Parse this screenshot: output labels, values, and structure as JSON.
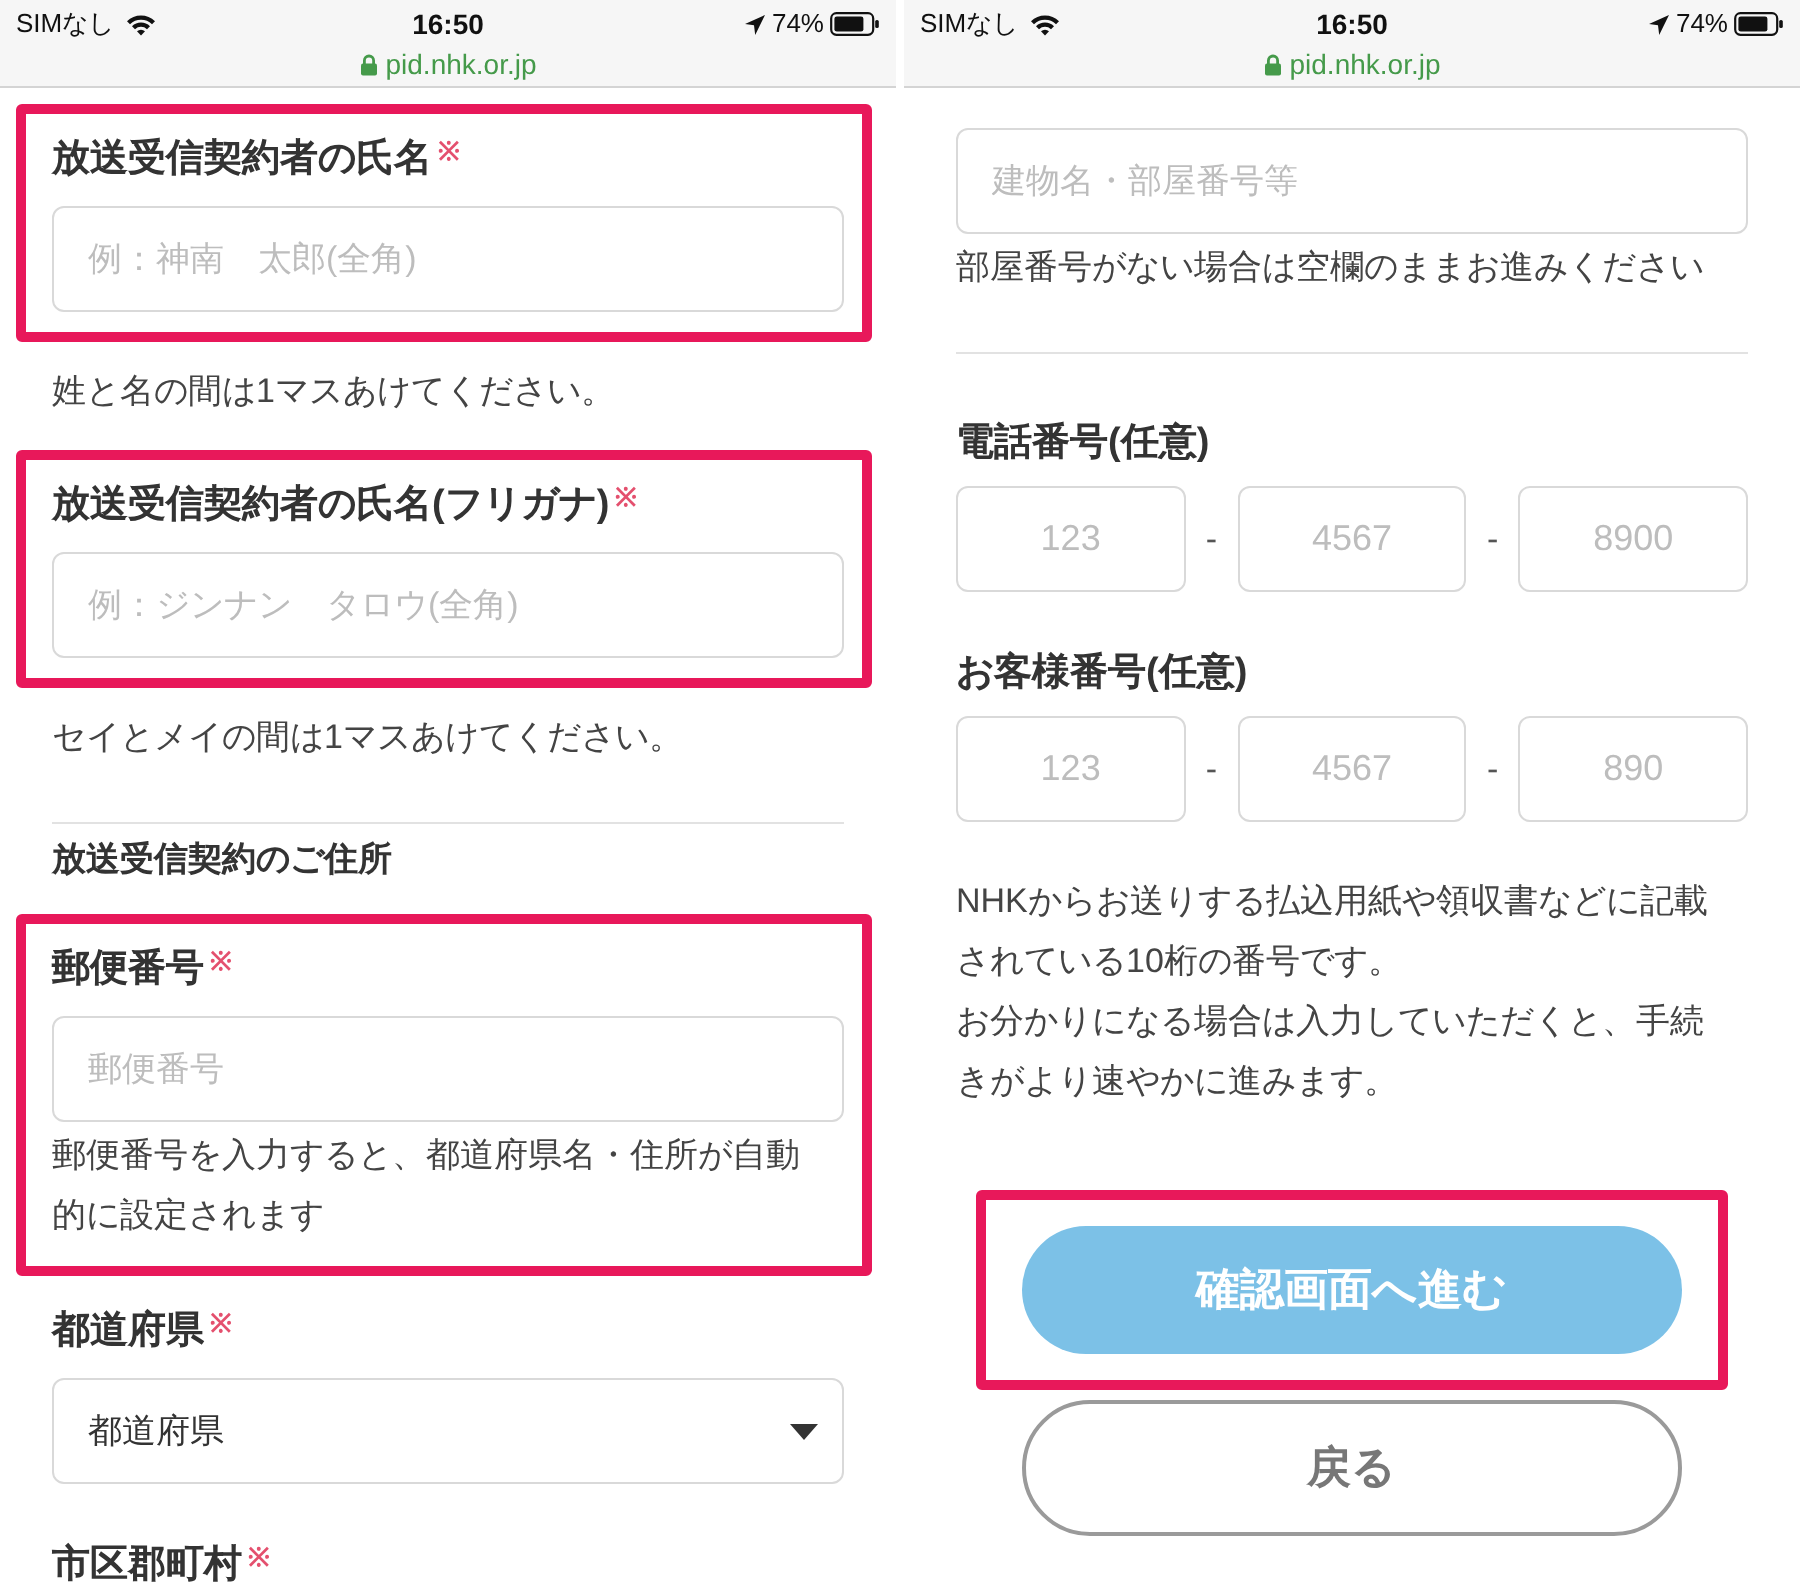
{
  "screens": [
    {
      "status_bar": {
        "carrier": "SIMなし",
        "time": "16:50",
        "battery": "74%"
      },
      "url": "pid.nhk.or.jp",
      "items": [
        {
          "kind": "field",
          "label": "放送受信契約者の氏名",
          "required_mark": "※",
          "placeholder": "例：神南　太郎(全角)",
          "highlighted": true
        },
        {
          "kind": "hint",
          "text": "姓と名の間は1マスあけてください。",
          "highlighted": false
        },
        {
          "kind": "field",
          "label": "放送受信契約者の氏名(フリガナ)",
          "required_mark": "※",
          "placeholder": "例：ジンナン　タロウ(全角)",
          "highlighted": true
        },
        {
          "kind": "hint",
          "text": "セイとメイの間は1マスあけてください。",
          "highlighted": false
        },
        {
          "kind": "divider",
          "highlighted": false
        },
        {
          "kind": "heading",
          "text": "放送受信契約のご住所",
          "highlighted": false
        },
        {
          "kind": "field",
          "label": "郵便番号",
          "required_mark": "※",
          "placeholder": "郵便番号",
          "highlighted": true
        },
        {
          "kind": "hint",
          "text": "郵便番号を入力すると、都道府県名・住所が自動的に設定されます",
          "highlighted": true
        },
        {
          "kind": "select",
          "label": "都道府県",
          "required_mark": "※",
          "value": "都道府県",
          "highlighted": false
        },
        {
          "kind": "label",
          "label": "市区郡町村",
          "required_mark": "※",
          "highlighted": false
        }
      ]
    },
    {
      "status_bar": {
        "carrier": "SIMなし",
        "time": "16:50",
        "battery": "74%"
      },
      "url": "pid.nhk.or.jp",
      "items": [
        {
          "kind": "input",
          "placeholder": "建物名・部屋番号等",
          "highlighted": false
        },
        {
          "kind": "hint",
          "text": "部屋番号がない場合は空欄のままお進みください",
          "highlighted": false
        },
        {
          "kind": "divider",
          "highlighted": false
        },
        {
          "kind": "split_field",
          "label": "電話番号(任意)",
          "parts": [
            {
              "placeholder": "123"
            },
            {
              "placeholder": "4567"
            },
            {
              "placeholder": "8900"
            }
          ],
          "separators": [
            "-",
            "-"
          ],
          "highlighted": false
        },
        {
          "kind": "split_field",
          "label": "お客様番号(任意)",
          "parts": [
            {
              "placeholder": "123"
            },
            {
              "placeholder": "4567"
            },
            {
              "placeholder": "890"
            }
          ],
          "separators": [
            "-",
            "-"
          ],
          "highlighted": false
        },
        {
          "kind": "note",
          "text": "NHKからお送りする払込用紙や領収書などに記載されている10桁の番号です。",
          "highlighted": false
        },
        {
          "kind": "note",
          "text": "お分かりになる場合は入力していただくと、手続きがより速やかに進みます。",
          "highlighted": false
        },
        {
          "kind": "submit_button",
          "label": "確認画面へ進む",
          "highlighted": true
        },
        {
          "kind": "back_button",
          "label": "戻る",
          "highlighted": false
        }
      ]
    }
  ]
}
